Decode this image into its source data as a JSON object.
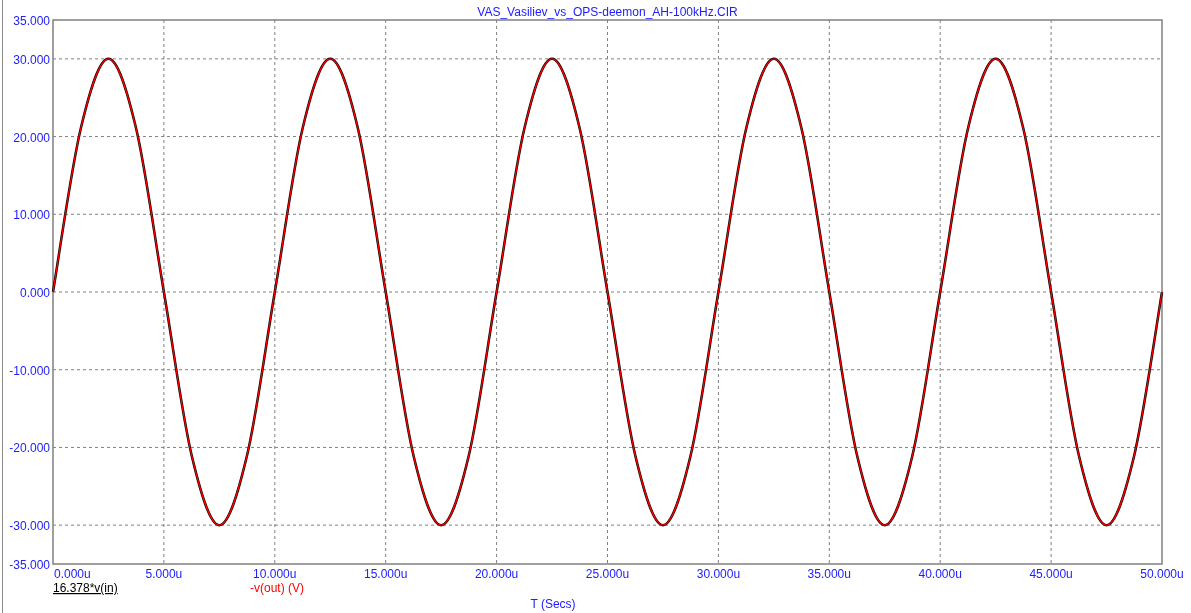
{
  "chart_data": {
    "type": "line",
    "title": "VAS_Vasiliev_vs_OPS-deemon_AH-100kHz.CIR",
    "xlabel": "T (Secs)",
    "x": [
      0,
      1.25,
      2.5,
      3.75,
      5,
      6.25,
      7.5,
      8.75,
      10,
      11.25,
      12.5,
      13.75,
      15,
      16.25,
      17.5,
      18.75,
      20,
      21.25,
      22.5,
      23.75,
      25,
      26.25,
      27.5,
      28.75,
      30,
      31.25,
      32.5,
      33.75,
      35,
      36.25,
      37.5,
      38.75,
      40,
      41.25,
      42.5,
      43.75,
      45,
      46.25,
      47.5,
      48.75,
      50
    ],
    "series": [
      {
        "name": "16.378*v(in)",
        "color": "#000000",
        "values": [
          0,
          21,
          30,
          21,
          0,
          -21,
          -30,
          -21,
          0,
          21,
          30,
          21,
          0,
          -21,
          -30,
          -21,
          0,
          21,
          30,
          21,
          0,
          -21,
          -30,
          -21,
          0,
          21,
          30,
          21,
          0,
          -21,
          -30,
          -21,
          0,
          21,
          30,
          21,
          0,
          -21,
          -30,
          -21,
          0
        ]
      },
      {
        "name": "-v(out) (V)",
        "color": "#ff0000",
        "values": [
          0,
          21,
          30,
          21,
          0,
          -21,
          -30,
          -21,
          0,
          21,
          30,
          21,
          0,
          -21,
          -30,
          -21,
          0,
          21,
          30,
          21,
          0,
          -21,
          -30,
          -21,
          0,
          21,
          30,
          21,
          0,
          -21,
          -30,
          -21,
          0,
          21,
          30,
          21,
          0,
          -21,
          -30,
          -21,
          0
        ]
      }
    ],
    "xlim": [
      0,
      50
    ],
    "ylim": [
      -35,
      35
    ],
    "grid": true,
    "xticks": [
      {
        "value": 0,
        "label": "0.000u"
      },
      {
        "value": 5,
        "label": "5.000u"
      },
      {
        "value": 10,
        "label": "10.000u"
      },
      {
        "value": 15,
        "label": "15.000u"
      },
      {
        "value": 20,
        "label": "20.000u"
      },
      {
        "value": 25,
        "label": "25.000u"
      },
      {
        "value": 30,
        "label": "30.000u"
      },
      {
        "value": 35,
        "label": "35.000u"
      },
      {
        "value": 40,
        "label": "40.000u"
      },
      {
        "value": 45,
        "label": "45.000u"
      },
      {
        "value": 50,
        "label": "50.000u"
      }
    ],
    "yticks": [
      {
        "value": 35,
        "label": "35.000"
      },
      {
        "value": 30,
        "label": "30.000"
      },
      {
        "value": 20,
        "label": "20.000"
      },
      {
        "value": 10,
        "label": "10.000"
      },
      {
        "value": 0,
        "label": "0.000"
      },
      {
        "value": -10,
        "label": "-10.000"
      },
      {
        "value": -20,
        "label": "-20.000"
      },
      {
        "value": -30,
        "label": "-30.000"
      },
      {
        "value": -35,
        "label": "-35.000"
      }
    ]
  }
}
